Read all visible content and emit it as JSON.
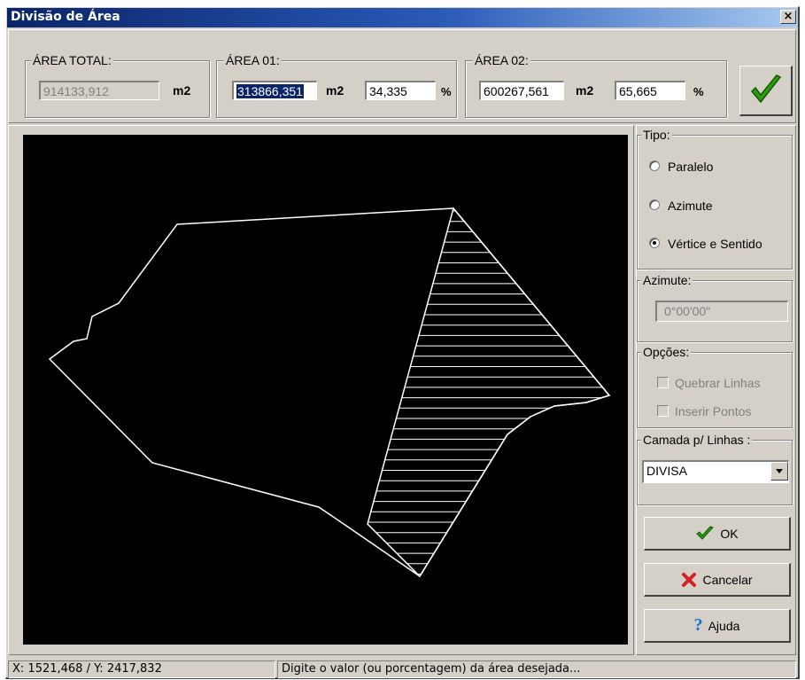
{
  "window": {
    "title": "Divisão de Área",
    "close_glyph": "×"
  },
  "area_total": {
    "label": "ÁREA TOTAL:",
    "value": "914133,912",
    "unit": "m2"
  },
  "area_01": {
    "label": "ÁREA 01:",
    "value": "313866,351",
    "unit": "m2",
    "percent": "34,335",
    "percent_unit": "%"
  },
  "area_02": {
    "label": "ÁREA 02:",
    "value": "600267,561",
    "unit": "m2",
    "percent": "65,665",
    "percent_unit": "%"
  },
  "apply_icon": "checkmark-icon",
  "tipo": {
    "label": "Tipo:",
    "options": [
      {
        "label": "Paralelo",
        "selected": false
      },
      {
        "label": "Azimute",
        "selected": false
      },
      {
        "label": "Vértice e Sentido",
        "selected": true
      }
    ]
  },
  "azimute": {
    "label": "Azimute:",
    "value": "0°00'00\""
  },
  "opcoes": {
    "label": "Opções:",
    "items": [
      {
        "label": "Quebrar Linhas",
        "checked": false,
        "enabled": false
      },
      {
        "label": "Inserir Pontos",
        "checked": false,
        "enabled": false
      }
    ]
  },
  "camada": {
    "label": "Camada p/ Linhas :",
    "selected": "DIVISA"
  },
  "buttons": {
    "ok": {
      "label": "OK",
      "icon": "green-check-icon"
    },
    "cancel": {
      "label": "Cancelar",
      "icon": "red-x-icon"
    },
    "help": {
      "label": "Ajuda",
      "icon": "question-icon"
    }
  },
  "status": {
    "coordinates": "X: 1521,468 / Y: 2417,832",
    "message": "Digite o valor (ou porcentagem) da área desejada..."
  },
  "colors": {
    "canvas_bg": "#000000",
    "outline": "#ffffff",
    "titlebar_start": "#0a246a",
    "selection": "#0a246a",
    "ok_check": "#2e9a12",
    "cancel_x": "#d42020",
    "help_q": "#1a6fd8"
  }
}
